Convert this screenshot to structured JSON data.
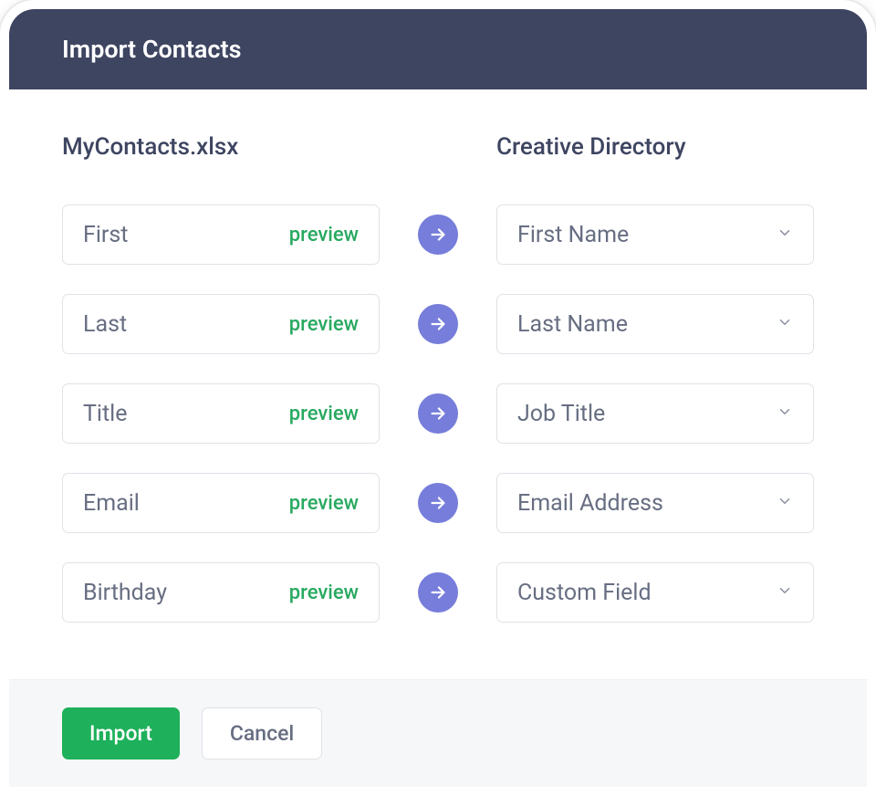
{
  "header": {
    "title": "Import Contacts"
  },
  "columns": {
    "source_title": "MyContacts.xlsx",
    "target_title": "Creative Directory"
  },
  "preview_label": "preview",
  "mappings": [
    {
      "source": "First",
      "target": "First Name"
    },
    {
      "source": "Last",
      "target": "Last Name"
    },
    {
      "source": "Title",
      "target": "Job Title"
    },
    {
      "source": "Email",
      "target": "Email Address"
    },
    {
      "source": "Birthday",
      "target": "Custom Field"
    }
  ],
  "footer": {
    "import_label": "Import",
    "cancel_label": "Cancel"
  }
}
